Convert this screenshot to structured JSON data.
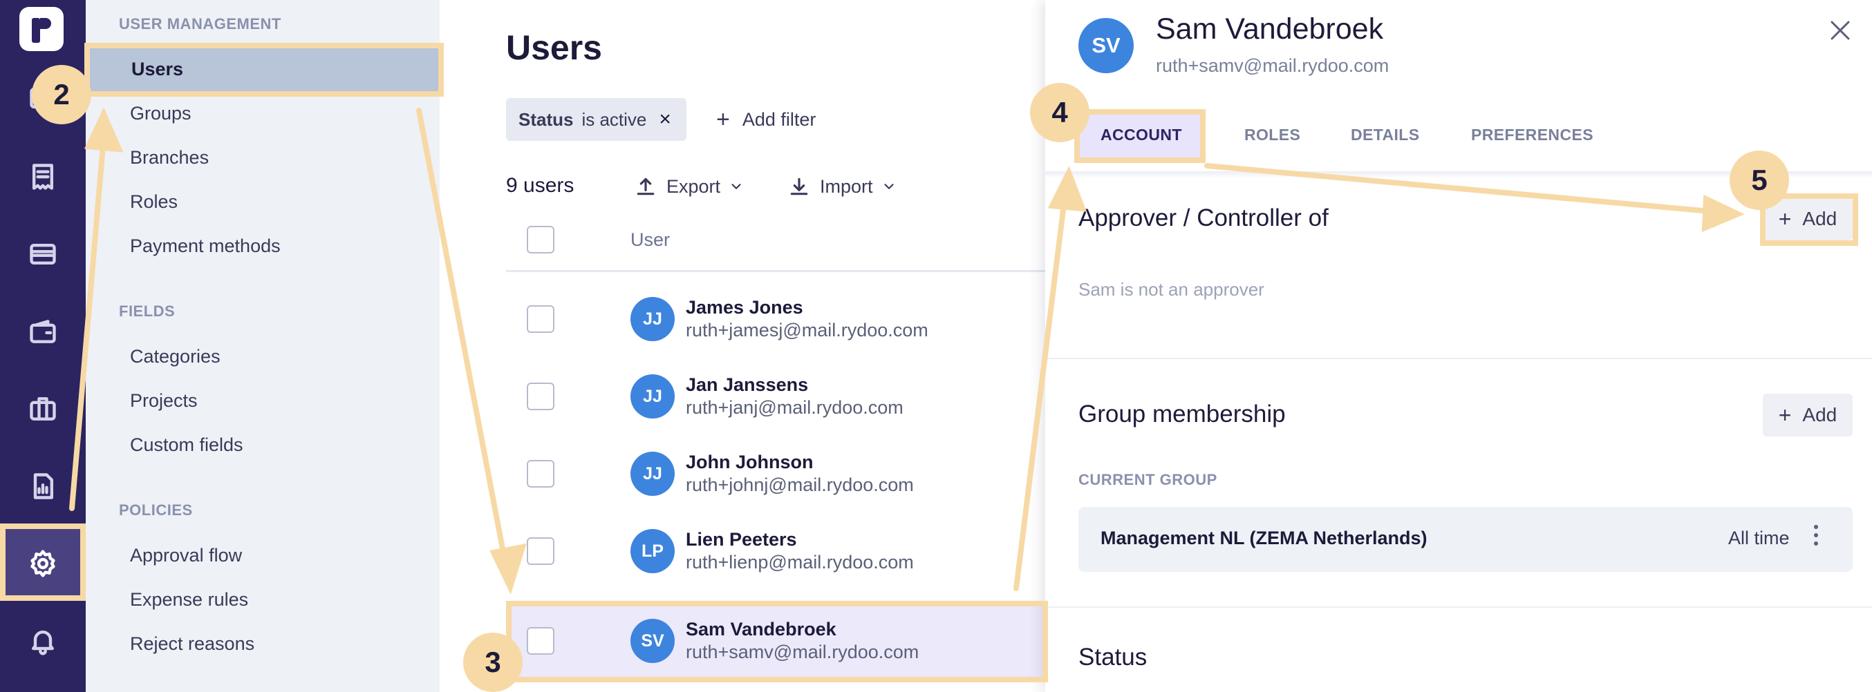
{
  "sidebar": {
    "sections": [
      {
        "title": "USER MANAGEMENT",
        "items": [
          "Users",
          "Groups",
          "Branches",
          "Roles",
          "Payment methods"
        ]
      },
      {
        "title": "FIELDS",
        "items": [
          "Categories",
          "Projects",
          "Custom fields"
        ]
      },
      {
        "title": "POLICIES",
        "items": [
          "Approval flow",
          "Expense rules",
          "Reject reasons"
        ]
      }
    ],
    "active_item": "Users"
  },
  "rail": {
    "icons": [
      "logo",
      "dashboard-icon",
      "receipt-icon",
      "card-icon",
      "wallet-icon",
      "briefcase-icon",
      "report-icon",
      "gear-icon",
      "bell-icon"
    ],
    "active": "gear-icon"
  },
  "main": {
    "title": "Users",
    "filter": {
      "field": "Status",
      "value": "is active",
      "remove": "×"
    },
    "add_filter": "Add filter",
    "count": "9 users",
    "export": "Export",
    "import": "Import",
    "column_user": "User",
    "users": [
      {
        "initials": "JJ",
        "name": "James Jones",
        "email": "ruth+jamesj@mail.rydoo.com"
      },
      {
        "initials": "JJ",
        "name": "Jan Janssens",
        "email": "ruth+janj@mail.rydoo.com"
      },
      {
        "initials": "JJ",
        "name": "John Johnson",
        "email": "ruth+johnj@mail.rydoo.com"
      },
      {
        "initials": "LP",
        "name": "Lien Peeters",
        "email": "ruth+lienp@mail.rydoo.com"
      },
      {
        "initials": "SV",
        "name": "Sam Vandebroek",
        "email": "ruth+samv@mail.rydoo.com"
      }
    ]
  },
  "panel": {
    "initials": "SV",
    "name": "Sam Vandebroek",
    "email": "ruth+samv@mail.rydoo.com",
    "tabs": [
      "ACCOUNT",
      "ROLES",
      "DETAILS",
      "PREFERENCES"
    ],
    "active_tab": "ACCOUNT",
    "approver_title": "Approver / Controller of",
    "add_label": "Add",
    "approver_empty": "Sam is not an approver",
    "group_title": "Group membership",
    "current_group_label": "CURRENT GROUP",
    "group_name": "Management NL (ZEMA Netherlands)",
    "group_period": "All time",
    "status_title": "Status"
  },
  "tutorial": {
    "steps": [
      "2",
      "3",
      "4",
      "5"
    ],
    "highlight_color": "#f7d9a6"
  },
  "colors": {
    "rail": "#2b2460",
    "avatar": "#3d84de",
    "selected_row": "#ece9fb",
    "active_tab_bg": "#e7e4fb"
  }
}
